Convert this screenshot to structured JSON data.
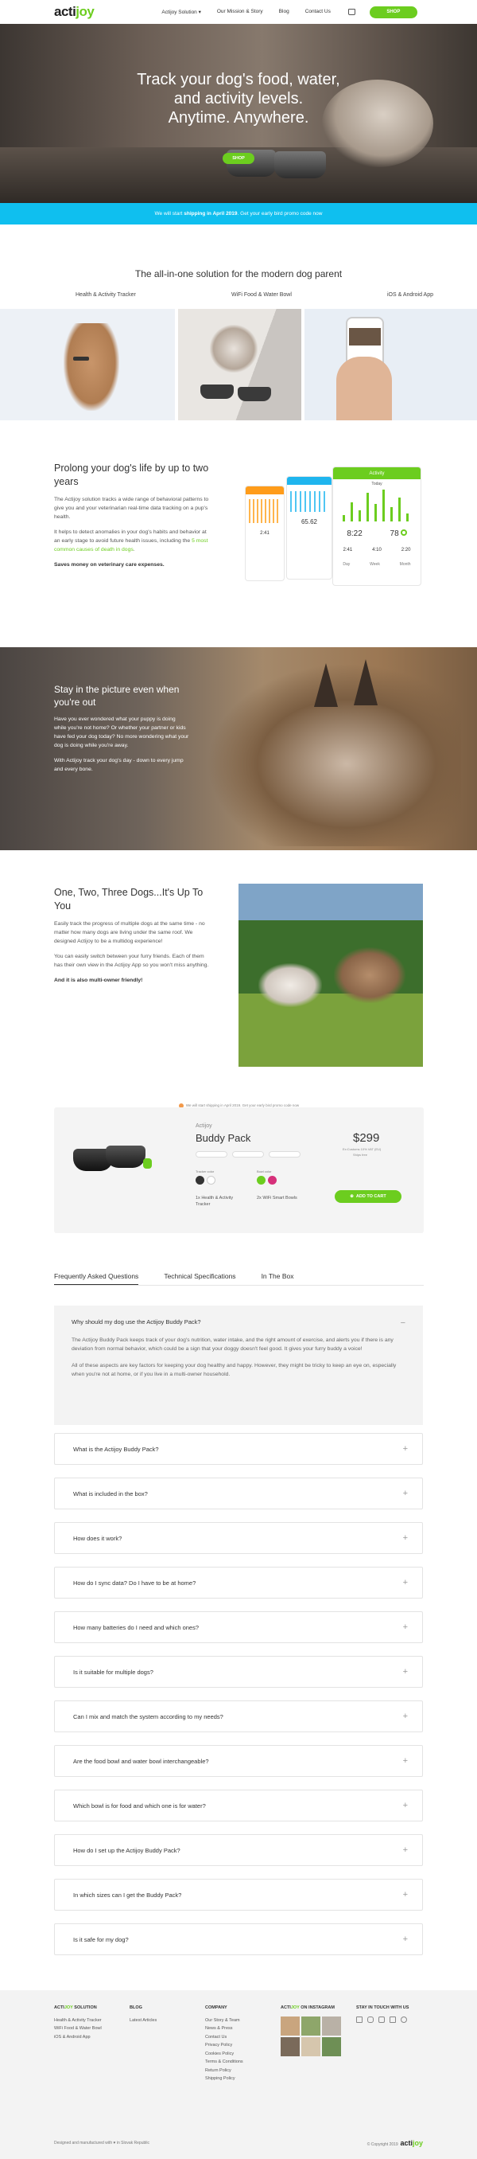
{
  "header": {
    "logo_main": "acti",
    "logo_accent": "joy",
    "nav": [
      "Actijoy Solution ▾",
      "Our Mission & Story",
      "Blog",
      "Contact Us"
    ],
    "shop": "SHOP"
  },
  "hero": {
    "title_line1": "Track your dog's food, water,",
    "title_line2": "and activity levels.",
    "title_line3": "Anytime. Anywhere.",
    "button": "SHOP"
  },
  "promo": {
    "text_pre": "We will start ",
    "text_bold": "shipping in April 2019",
    "text_post": ". Get your early bird promo code now"
  },
  "solution": {
    "title": "The all-in-one solution for the modern dog parent",
    "tabs": [
      "Health & Activity Tracker",
      "WiFi Food & Water Bowl",
      "iOS & Android App"
    ]
  },
  "prolong": {
    "title": "Prolong your dog's life by up to two years",
    "p1": "The Actijoy solution tracks a wide range of behavioral patterns to give you and your veterinarian real-time data tracking on a pup's health.",
    "p2_pre": "It helps to detect anomalies in your dog's habits and behavior at an early stage to avoid future health issues, including the ",
    "p2_link": "5 most common causes of death in dogs",
    "p2_post": ".",
    "p3": "Saves money on veterinary care expenses.",
    "app": {
      "header": "Activity",
      "today": "Today",
      "stat1": "8:22",
      "stat2": "78",
      "stat3": "65.62",
      "stat4": "2:41",
      "stat5": "4:10",
      "stat6": "2:20",
      "tabs": [
        "Day",
        "Week",
        "Month"
      ]
    }
  },
  "stay": {
    "title": "Stay in the picture even when you're out",
    "p1": "Have you ever wondered what your puppy is doing while you're not home? Or whether your partner or kids have fed your dog today? No more wondering what your dog is doing while you're away.",
    "p2": "With Actijoy track your dog's day - down to every jump and every bone."
  },
  "three": {
    "title": "One, Two, Three Dogs...It's Up To You",
    "p1": "Easily track the progress of multiple dogs at the same time - no matter how many dogs are living under the same roof. We designed Actijoy to be a multidog experience!",
    "p2": "You can easily switch between your furry friends. Each of them has their own view in the Actijoy App so you won't miss anything.",
    "p3": "And it is also multi-owner friendly!"
  },
  "product": {
    "ship_note": "We will start shipping in April 2019. Get your early bird promo code now",
    "brand": "Actijoy",
    "name": "Buddy Pack",
    "price": "$299",
    "price_note1": "Ex:Customs 10% VAT (EU)",
    "price_note2": "Ships free",
    "label_tracker": "Tracker color",
    "label_bowl": "Bowl color",
    "item1": "1x Health & Activity Tracker",
    "item2": "2x WiFi Smart Bowls",
    "add_to_cart": "ADD TO CART",
    "colors": {
      "black": "#333333",
      "white": "#ffffff",
      "green": "#6ccd1f",
      "pink": "#d6307a"
    }
  },
  "faq_tabs": [
    "Frequently Asked Questions",
    "Technical Specifications",
    "In The Box"
  ],
  "faq_open": {
    "q": "Why should my dog use the Actijoy Buddy Pack?",
    "a1": "The Actijoy Buddy Pack keeps track of your dog's nutrition, water intake, and the right amount of exercise, and alerts you if there is any deviation from normal behavior, which could be a sign that your doggy doesn't feel good. It gives your furry buddy a voice!",
    "a2": "All of these aspects are key factors for keeping your dog healthy and happy. However, they might be tricky to keep an eye on, especially when you're not at home, or if you live in a multi-owner household."
  },
  "faqs": [
    "What is the Actijoy Buddy Pack?",
    "What is included in the box?",
    "How does it work?",
    "How do I sync data? Do I have to be at home?",
    "How many batteries do I need and which ones?",
    "Is it suitable for multiple dogs?",
    "Can I mix and match the system according to my needs?",
    "Are the food bowl and water bowl interchangeable?",
    "Which bowl is for food and which one is for water?",
    "How do I set up the Actijoy Buddy Pack?",
    "In which sizes can I get the Buddy Pack?",
    "Is it safe for my dog?"
  ],
  "footer": {
    "col1_title_main": "ACTI",
    "col1_title_accent": "JOY",
    "col1_title_rest": " SOLUTION",
    "col1": [
      "Health & Activity Tracker",
      "WiFi Food & Water Bowl",
      "iOS & Android App"
    ],
    "col2_title": "BLOG",
    "col2": [
      "Latest Articles"
    ],
    "col3_title": "COMPANY",
    "col3": [
      "Our Story & Team",
      "News & Press",
      "Contact Us",
      "Privacy Policy",
      "Cookies Policy",
      "Terms & Conditions",
      "Return Policy",
      "Shipping Policy"
    ],
    "col4_title_main": "ACTI",
    "col4_title_accent": "JOY",
    "col4_title_rest": " ON INSTAGRAM",
    "col5_title": "STAY IN TOUCH WITH US",
    "bottom_left": "Designed and manufactured with ♥ in Slovak Republic",
    "bottom_right": "© Copyright 2019"
  }
}
